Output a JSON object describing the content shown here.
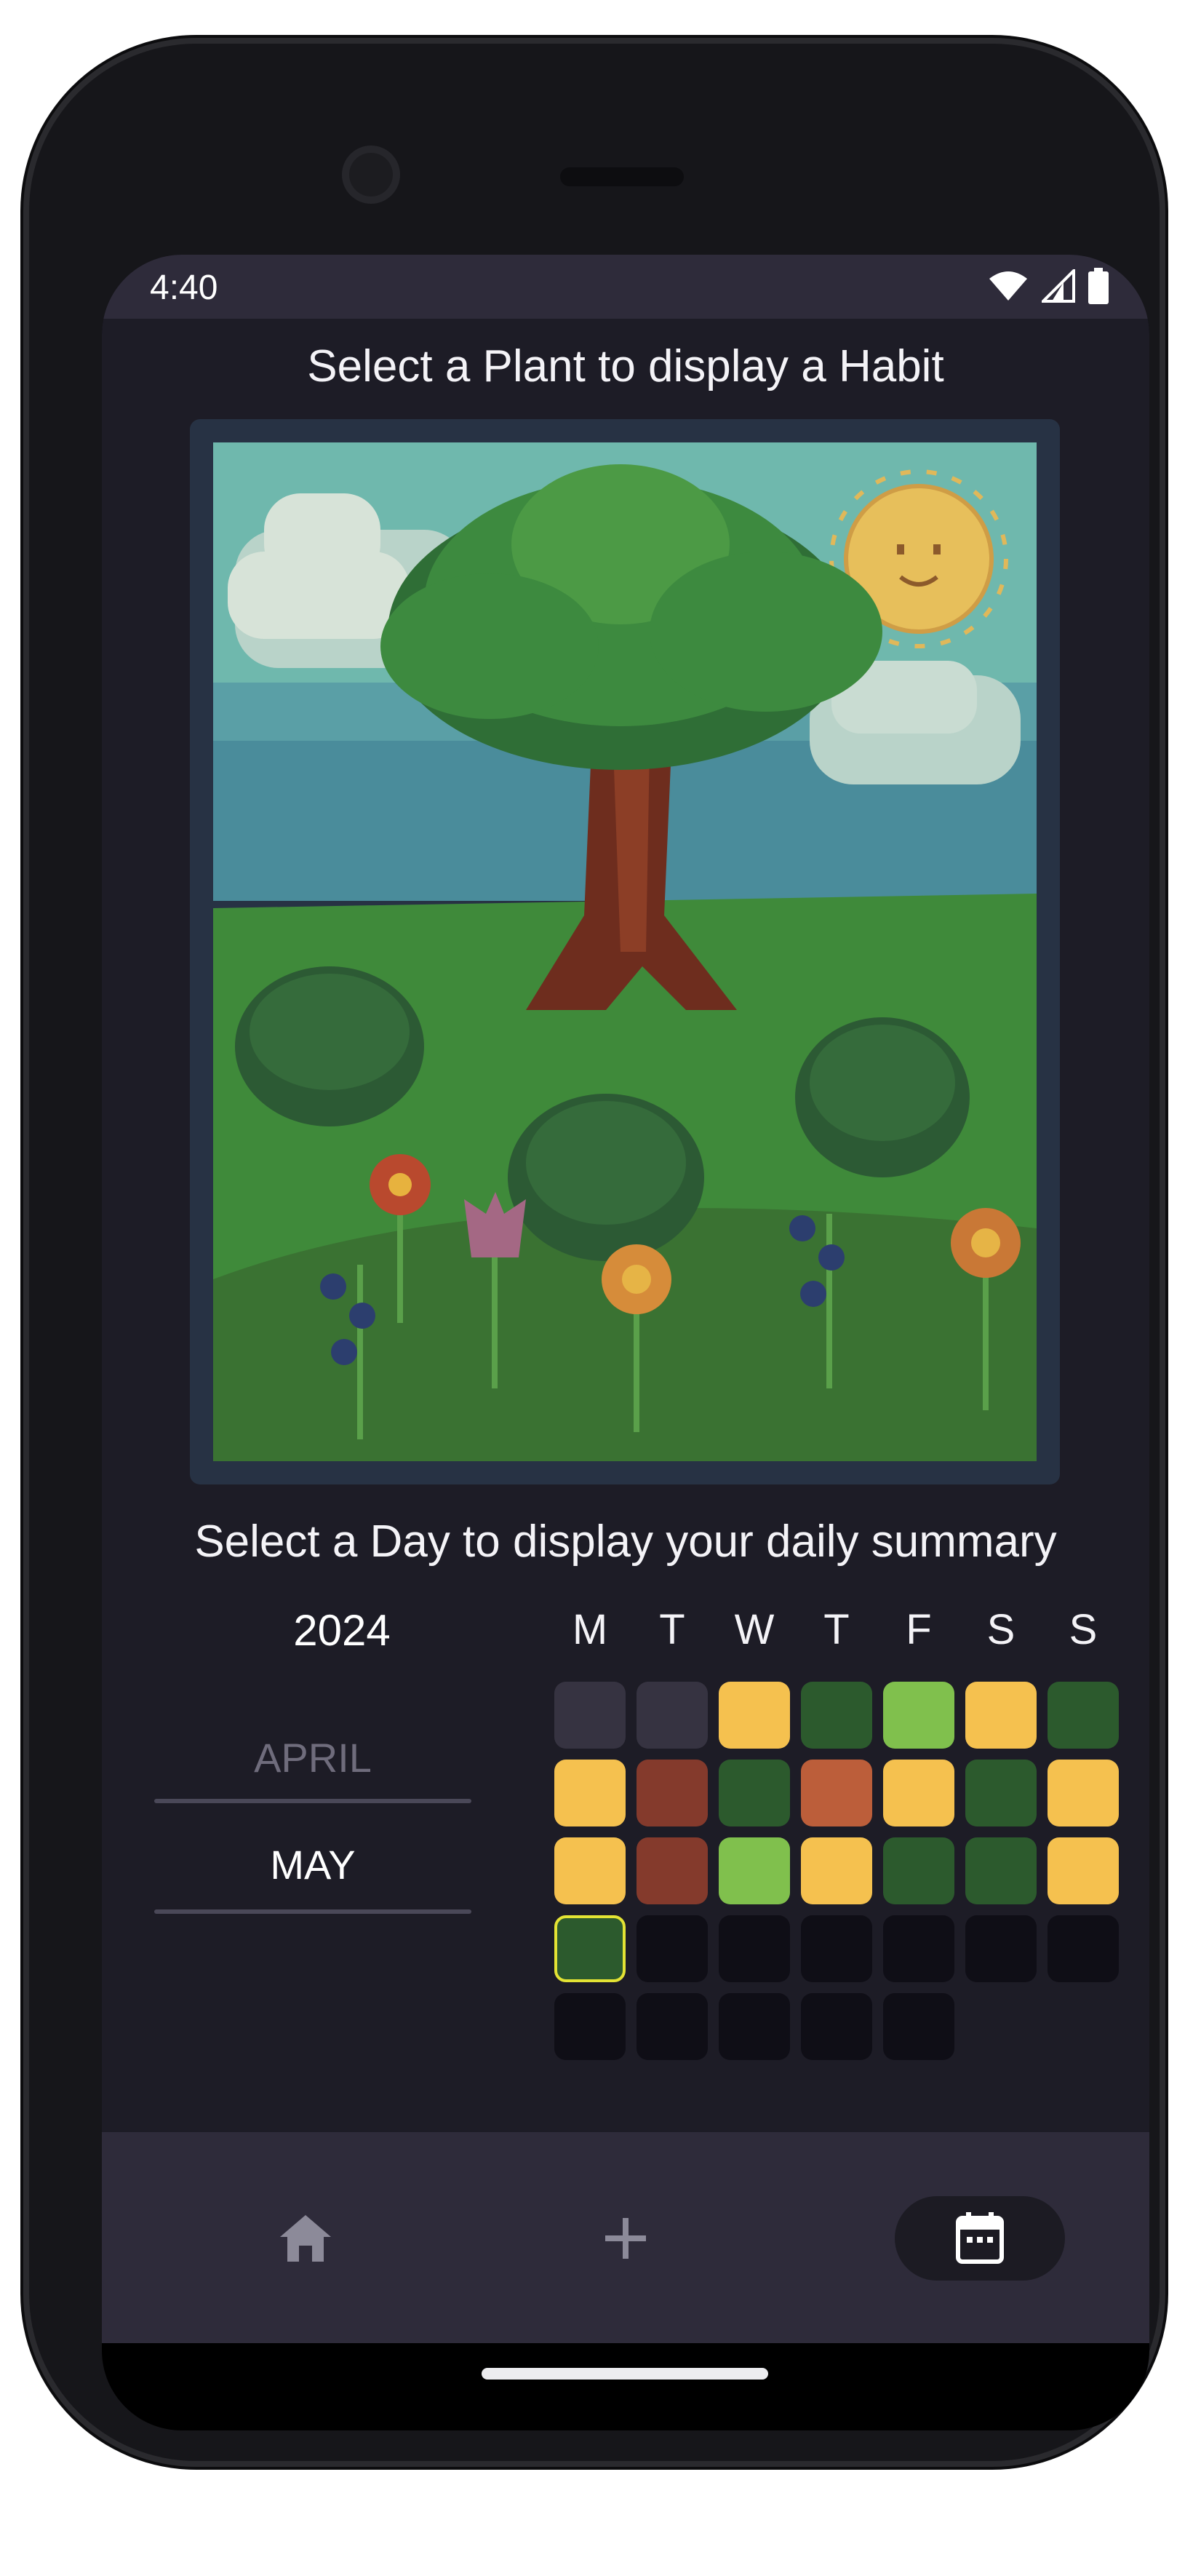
{
  "status_bar": {
    "time": "4:40",
    "icons": [
      "wifi-icon",
      "signal-icon",
      "battery-icon"
    ]
  },
  "plant_section": {
    "title": "Select a Plant to display a Habit",
    "image": "pixel-art-tree-garden"
  },
  "day_section": {
    "title": "Select a Day to display your daily summary",
    "year": "2024",
    "months": [
      "APRIL",
      "MAY"
    ],
    "selected_month": "MAY",
    "weekdays": [
      "M",
      "T",
      "W",
      "T",
      "F",
      "S",
      "S"
    ],
    "legend_colors": {
      "empty": "#363341",
      "future": "#0f0e16",
      "yellow": "#f5c14f",
      "dark_green": "#2c5a2d",
      "light_green": "#80c04d",
      "red_brown": "#843a2c",
      "orange": "#bc5e3a"
    },
    "weeks": [
      [
        "empty",
        "empty",
        "yellow",
        "dark_green",
        "light_green",
        "yellow",
        "dark_green"
      ],
      [
        "yellow",
        "red_brown",
        "dark_green",
        "orange",
        "yellow",
        "dark_green",
        "yellow"
      ],
      [
        "yellow",
        "red_brown",
        "light_green",
        "yellow",
        "dark_green",
        "dark_green",
        "yellow"
      ],
      [
        "dark_green",
        "future",
        "future",
        "future",
        "future",
        "future",
        "future"
      ],
      [
        "future",
        "future",
        "future",
        "future",
        "future",
        null,
        null
      ]
    ],
    "today_highlight": {
      "week": 3,
      "day": 0,
      "color": "#e3e334"
    }
  },
  "bottom_nav": [
    {
      "name": "home",
      "icon": "home-icon",
      "active": false
    },
    {
      "name": "add",
      "icon": "plus-icon",
      "active": false
    },
    {
      "name": "calendar",
      "icon": "calendar-icon",
      "active": true
    }
  ]
}
